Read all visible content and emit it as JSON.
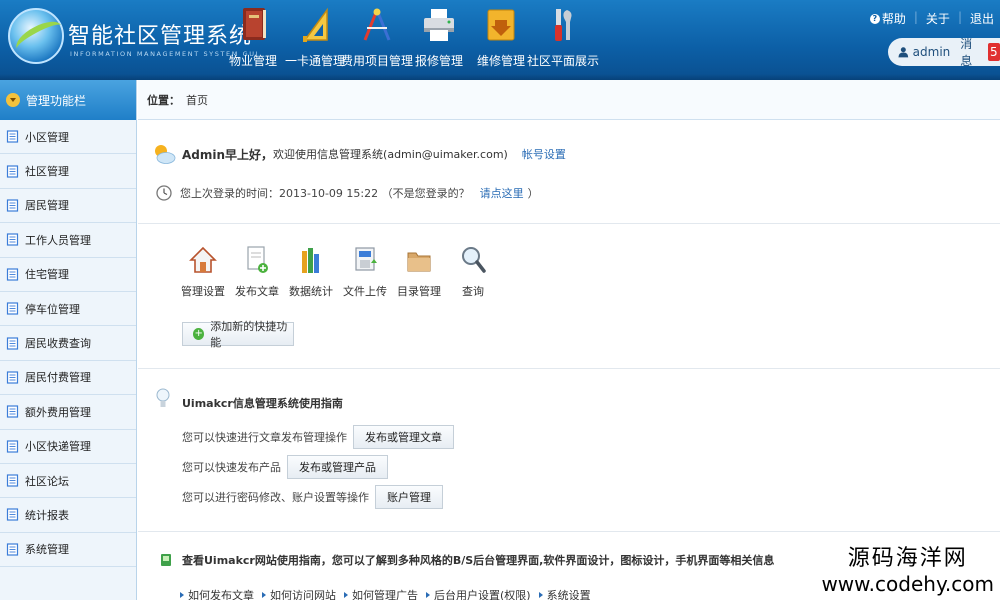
{
  "header": {
    "title": "智能社区管理系统",
    "subtitle": "INFORMATION MANAGEMENT SYSTEM GUI",
    "nav": [
      {
        "label": "物业管理",
        "icon": "book-icon"
      },
      {
        "label": "一卡通管理",
        "icon": "ruler-triangle-icon"
      },
      {
        "label": "费用项目管理",
        "icon": "compass-icon"
      },
      {
        "label": "报修管理",
        "icon": "printer-icon"
      },
      {
        "label": "维修管理",
        "icon": "download-box-icon"
      },
      {
        "label": "社区平面展示",
        "icon": "tools-icon"
      }
    ],
    "help": "帮助",
    "about": "关于",
    "logout": "退出",
    "username": "admin",
    "message_label": "消息",
    "message_count": "5"
  },
  "sidebar": {
    "title": "管理功能栏",
    "items": [
      {
        "label": "小区管理"
      },
      {
        "label": "社区管理"
      },
      {
        "label": "居民管理"
      },
      {
        "label": "工作人员管理"
      },
      {
        "label": "住宅管理"
      },
      {
        "label": "停车位管理"
      },
      {
        "label": "居民收费查询"
      },
      {
        "label": "居民付费管理"
      },
      {
        "label": "额外费用管理"
      },
      {
        "label": "小区快递管理"
      },
      {
        "label": "社区论坛"
      },
      {
        "label": "统计报表"
      },
      {
        "label": "系统管理"
      }
    ]
  },
  "breadcrumb": {
    "label": "位置：",
    "current": "首页"
  },
  "welcome": {
    "name": "Admin早上好，",
    "text": "欢迎使用信息管理系统(admin@uimaker.com)",
    "account_link": "帐号设置"
  },
  "last_login": {
    "text": "您上次登录的时间：2013-10-09 15:22 （不是您登录的？",
    "link": "请点这里",
    "close": "）"
  },
  "quick_items": [
    {
      "label": "管理设置",
      "icon": "home-icon"
    },
    {
      "label": "发布文章",
      "icon": "document-add-icon"
    },
    {
      "label": "数据统计",
      "icon": "books-icon"
    },
    {
      "label": "文件上传",
      "icon": "file-upload-icon"
    },
    {
      "label": "目录管理",
      "icon": "folder-icon"
    },
    {
      "label": "查询",
      "icon": "magnifier-icon"
    }
  ],
  "add_quick": "添加新的快捷功能",
  "guide": {
    "title": "Uimakcr信息管理系统使用指南",
    "rows": [
      {
        "text": "您可以快速进行文章发布管理操作",
        "button": "发布或管理文章"
      },
      {
        "text": "您可以快速发布产品",
        "button": "发布或管理产品"
      },
      {
        "text": "您可以进行密码修改、账户设置等操作",
        "button": "账户管理"
      }
    ]
  },
  "site_guide": {
    "text": "查看Uimakcr网站使用指南，您可以了解到多种风格的B/S后台管理界面,软件界面设计，图标设计，手机界面等相关信息",
    "links": [
      "如何发布文章",
      "如何访问网站",
      "如何管理广告",
      "后台用户设置(权限)",
      "系统设置"
    ]
  },
  "watermark": {
    "line1": "源码海洋网",
    "line2": "www.codehy.com"
  }
}
